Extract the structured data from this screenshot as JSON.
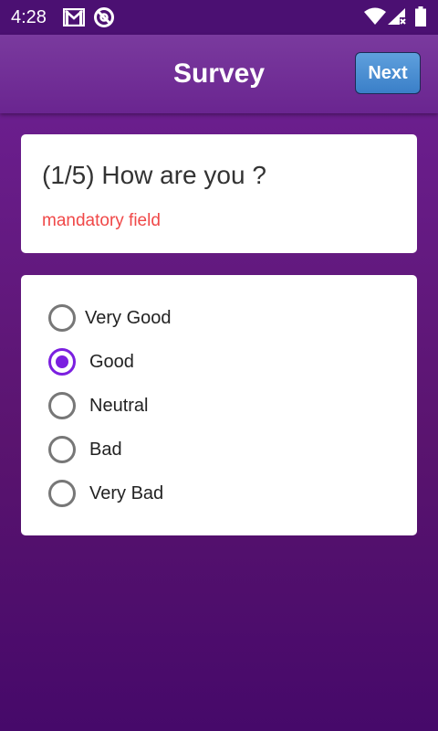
{
  "status_bar": {
    "time": "4:28",
    "icons": [
      "gmail-icon",
      "do-not-disturb-icon",
      "wifi-icon",
      "signal-icon",
      "battery-icon"
    ]
  },
  "app_bar": {
    "title": "Survey",
    "next_label": "Next"
  },
  "question": {
    "text": "(1/5) How are you ?",
    "mandatory_note": "mandatory field"
  },
  "options": [
    {
      "label": "Very Good",
      "selected": false
    },
    {
      "label": "Good",
      "selected": true
    },
    {
      "label": "Neutral",
      "selected": false
    },
    {
      "label": "Bad",
      "selected": false
    },
    {
      "label": "Very Bad",
      "selected": false
    }
  ],
  "colors": {
    "accent": "#7b1fe0",
    "mandatory": "#f04848",
    "next_button": "#4a8fd4",
    "background": "#5a146f"
  }
}
